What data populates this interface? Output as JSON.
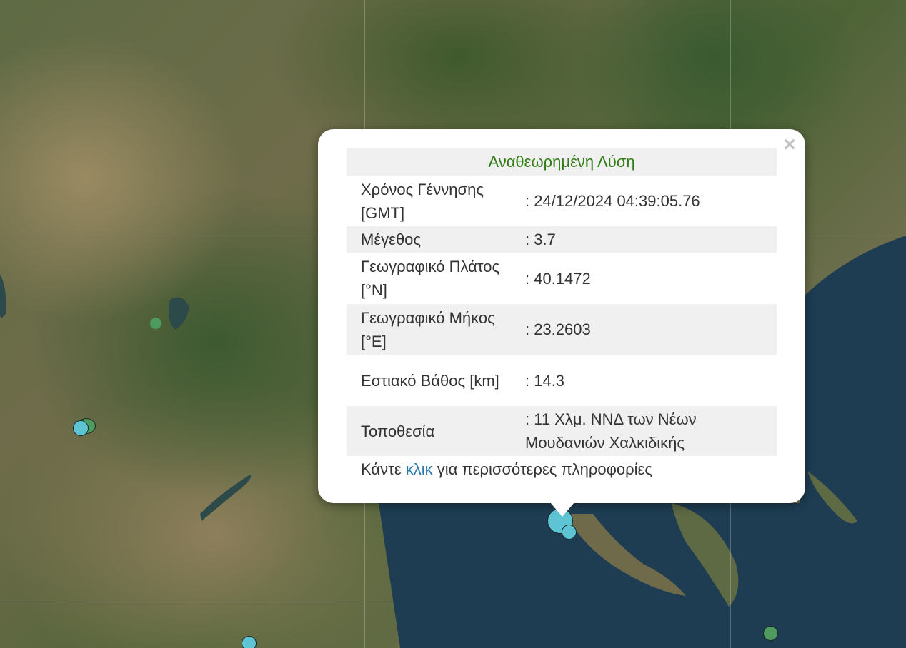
{
  "popup": {
    "title": "Αναθεωρημένη Λύση",
    "close_symbol": "×",
    "rows": [
      {
        "label": "Χρόνος Γέννησης [GMT]",
        "value": ": 24/12/2024 04:39:05.76"
      },
      {
        "label": "Μέγεθος",
        "value": ": 3.7"
      },
      {
        "label": "Γεωγραφικό Πλάτος [°N]",
        "value": ": 40.1472"
      },
      {
        "label": "Γεωγραφικό Μήκος [°E]",
        "value": ": 23.2603"
      },
      {
        "label": "Εστιακό Βάθος [km]",
        "value": ": 14.3"
      },
      {
        "label": "Τοποθεσία",
        "value": ": 11 Χλμ. ΝΝΔ των Νέων Μουδανιών Χαλκιδικής"
      }
    ],
    "footer": {
      "prefix": "Κάντε",
      "link": "κλικ",
      "suffix": "για περισσότερες πληροφορίες"
    }
  },
  "colors": {
    "title_green": "#2f7d14",
    "link_blue": "#2a7bb0",
    "quake_cyan": "#5ec4d4",
    "quake_green": "#4f9a5e",
    "sea": "#1f3f55"
  }
}
